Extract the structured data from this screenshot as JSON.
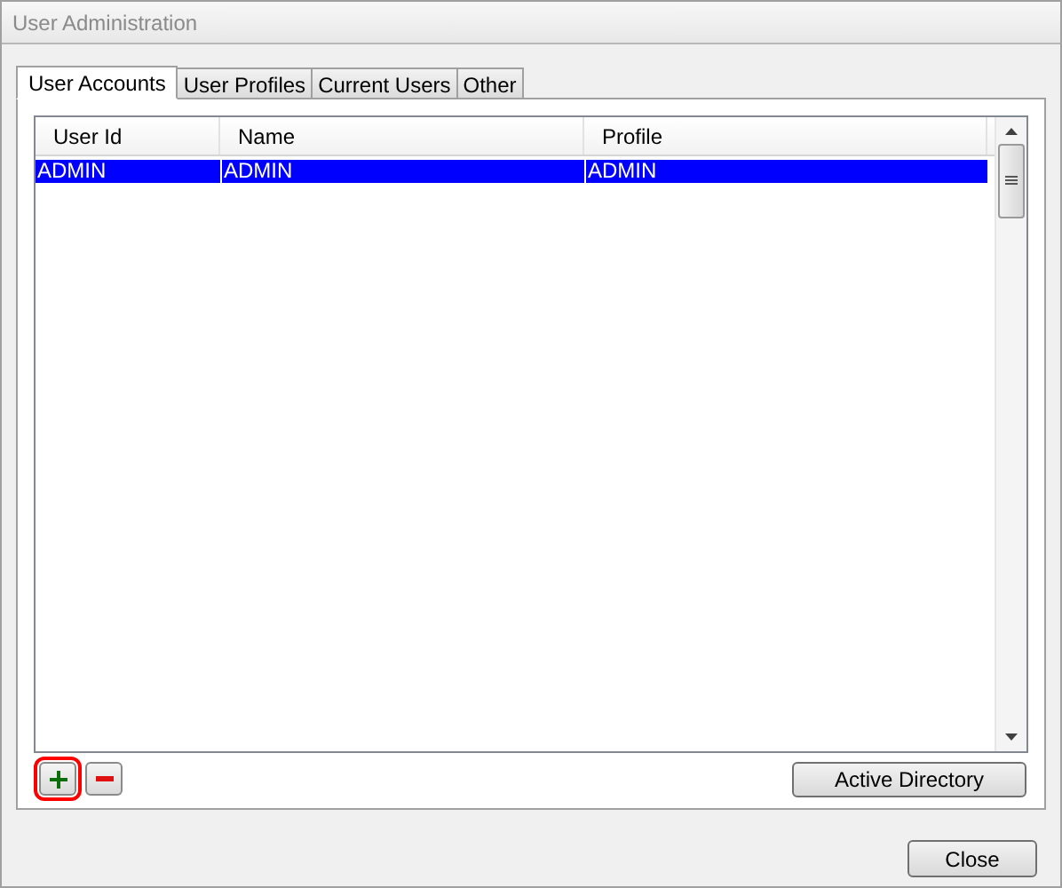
{
  "window": {
    "title": "User Administration"
  },
  "tabs": [
    {
      "label": "User Accounts",
      "selected": true
    },
    {
      "label": "User Profiles",
      "selected": false
    },
    {
      "label": "Current Users",
      "selected": false
    },
    {
      "label": "Other",
      "selected": false
    }
  ],
  "table": {
    "columns": [
      "User Id",
      "Name",
      "Profile"
    ],
    "rows": [
      {
        "cells": [
          "ADMIN",
          "ADMIN",
          "ADMIN"
        ],
        "selected": true
      }
    ]
  },
  "list_buttons": [
    {
      "kind": "add",
      "highlighted": true
    },
    {
      "kind": "remove",
      "highlighted": false
    }
  ],
  "active_directory_button": "Active Directory",
  "close_button": "Close"
}
